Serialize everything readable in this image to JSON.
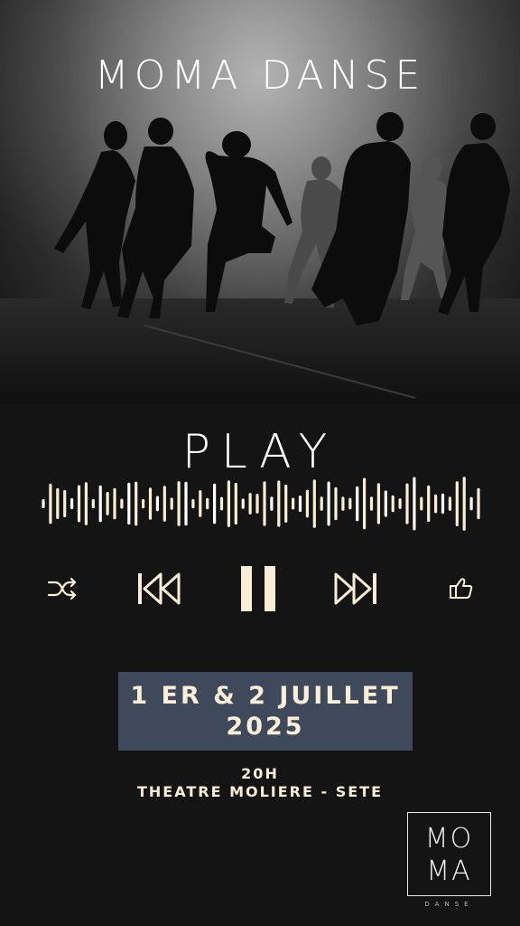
{
  "hero": {
    "title": "MOMA DANSE",
    "image": "dance-silhouettes-photo"
  },
  "player": {
    "title": "PLAY",
    "waveform_icon": "audio-waveform",
    "controls": [
      {
        "name": "shuffle-icon",
        "label": "shuffle"
      },
      {
        "name": "previous-icon",
        "label": "previous"
      },
      {
        "name": "pause-icon",
        "label": "pause"
      },
      {
        "name": "next-icon",
        "label": "next"
      },
      {
        "name": "like-icon",
        "label": "like"
      }
    ],
    "accent_color": "#fbeed6"
  },
  "event": {
    "date_line1": "1 ER & 2 JUILLET",
    "date_line2": "2025",
    "time": "20H",
    "venue": "THEATRE MOLIERE - SETE",
    "date_box_color": "#3e4a5c"
  },
  "logo": {
    "line1": "MO",
    "line2": "MA",
    "subtitle": "DANSE"
  }
}
